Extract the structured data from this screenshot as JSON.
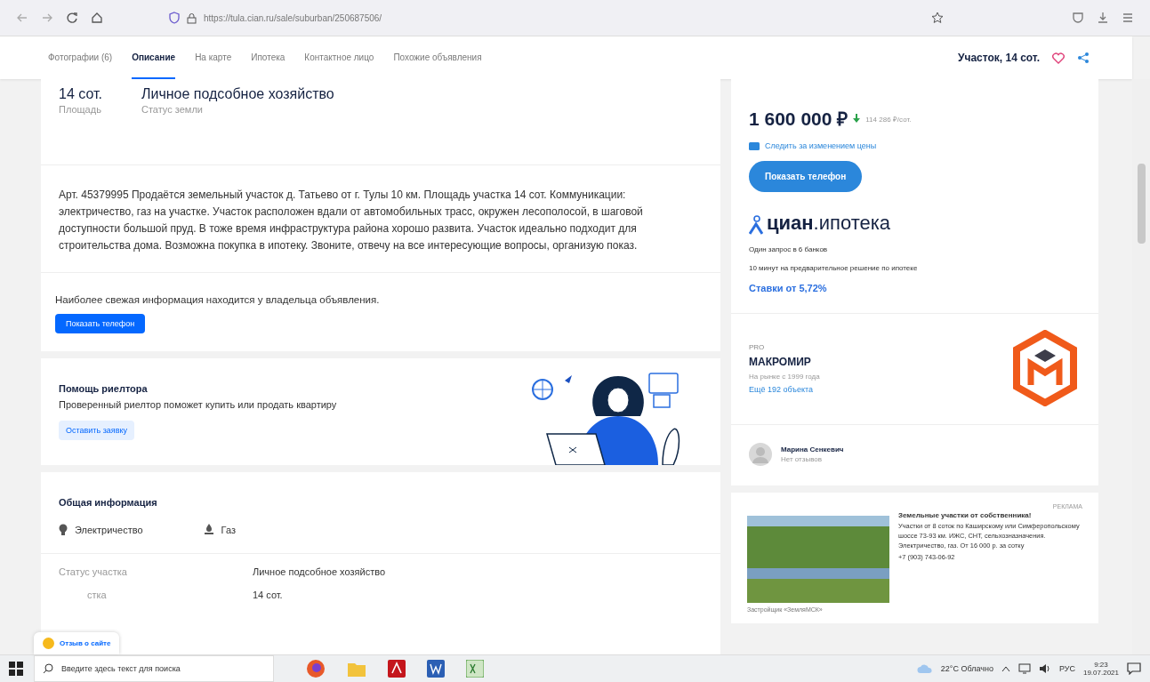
{
  "browser": {
    "url": "https://tula.cian.ru/sale/suburban/250687506/"
  },
  "nav": {
    "tabs": [
      {
        "label": "Фотографии (6)",
        "selected": false
      },
      {
        "label": "Описание",
        "selected": true
      },
      {
        "label": "На карте",
        "selected": false
      },
      {
        "label": "Ипотека",
        "selected": false
      },
      {
        "label": "Контактное лицо",
        "selected": false
      },
      {
        "label": "Похожие объявления",
        "selected": false
      }
    ],
    "title": "Участок, 14 сот."
  },
  "summary": [
    {
      "value": "14 сот.",
      "label": "Площадь"
    },
    {
      "value": "Личное подсобное хозяйство",
      "label": "Статус земли"
    }
  ],
  "description": "Арт. 45379995 Продаётся земельный участок д. Татьево от г. Тулы 10 км. Площадь участка 14 сот. Коммуникации: электричество, газ на участке. Участок расположен вдали от автомобильных трасс, окружен лесополосой, в шаговой доступности большой пруд. В тоже время инфраструктура района хорошо развита. Участок идеально подходит для строительства дома. Возможна покупка в ипотеку. Звоните, отвечу на все интересующие вопросы, организую показ.",
  "owner_note": {
    "text": "Наиболее свежая информация находится у владельца объявления.",
    "button": "Показать телефон"
  },
  "realtor": {
    "title": "Помощь риелтора",
    "text": "Проверенный риелтор поможет купить или продать квартиру",
    "button": "Оставить заявку"
  },
  "general": {
    "title": "Общая информация",
    "utilities": [
      {
        "kind": "bulb",
        "label": "Электричество"
      },
      {
        "kind": "gas",
        "label": "Газ"
      }
    ],
    "rows": [
      {
        "label": "Статус участка",
        "value": "Личное подсобное хозяйство",
        "label_covered": false
      },
      {
        "label": "стка",
        "value": "14 сот.",
        "label_covered": true
      }
    ]
  },
  "feedback_button": "Отзыв о сайте",
  "price": {
    "value": "1 600 000 ₽",
    "per_unit": "114 286 ₽/сот.",
    "watch": "Следить за изменением цены",
    "button": "Показать телефон"
  },
  "mortgage": {
    "brand": "циан",
    "brand_suffix": ".ипотека",
    "lines": [
      "Один запрос в 6 банков",
      "10 минут на предварительное решение по ипотеке"
    ],
    "rates": "Ставки от 5,72%"
  },
  "agency": {
    "badge": "PRO",
    "name": "МАКРОМИР",
    "since": "На рынке с 1999 года",
    "more": "Ещё 192 объекта"
  },
  "agent": {
    "name": "Марина Сенкевич",
    "reviews": "Нет отзывов"
  },
  "ad": {
    "label": "РЕКЛАМА",
    "title": "Земельные участки от собственника!",
    "text": "Участки от 8 соток по Каширскому или Симферопольскому шоссе 73-93 км. ИЖС, СНТ, сельхозназначения. Электричество, газ. От 16 000 р. за сотку",
    "phone": "+7 (903) 743-06-92",
    "footer": "Застройщик «ЗемляМСК»"
  },
  "taskbar": {
    "search_placeholder": "Введите здесь текст для поиска",
    "weather": "22°C  Облачно",
    "language": "РУС",
    "time": "9:23",
    "date": "19.07.2021"
  }
}
